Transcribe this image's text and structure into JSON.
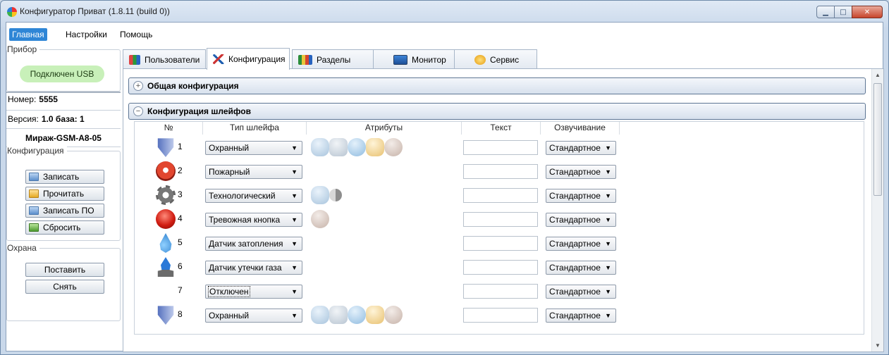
{
  "window": {
    "title": "Конфигуратор Приват (1.8.11 (build 0))",
    "min_glyph": "▁",
    "max_glyph": "□",
    "close_glyph": "✕"
  },
  "menu": [
    "Главная",
    "Настройки",
    "Помощь"
  ],
  "side": {
    "device_group": "Прибор",
    "usb_status": "Подключен USB",
    "number_label": "Номер:",
    "number_value": "5555",
    "version_label": "Версия:",
    "version_value": "1.0 база: 1",
    "device_name": "Мираж-GSM-A8-05",
    "config_group": "Конфигурация",
    "config_buttons": [
      "Записать",
      "Прочитать",
      "Записать ПО",
      "Сбросить"
    ],
    "guard_group": "Охрана",
    "guard_buttons": [
      "Поставить",
      "Снять"
    ]
  },
  "tabs": [
    "Пользователи",
    "Конфигурация",
    "Разделы",
    "Монитор",
    "Сервис"
  ],
  "panels": {
    "general": "Общая конфигурация",
    "loops": "Конфигурация шлейфов",
    "collapsed": "+",
    "expanded": "−"
  },
  "table": {
    "headers": [
      "№",
      "Тип шлейфа",
      "Атрибуты",
      "Текст",
      "Озвучивание"
    ],
    "rows": [
      {
        "num": "1",
        "icon": "shield-icon",
        "type": "Охранный",
        "sound": "Стандартное",
        "attrs": [
          "person-icon",
          "home-icon",
          "cycle-icon",
          "hand-icon",
          "sound-off-icon"
        ]
      },
      {
        "num": "2",
        "icon": "fire-icon",
        "type": "Пожарный",
        "sound": "Стандартное",
        "attrs": []
      },
      {
        "num": "3",
        "icon": "gear-icon",
        "type": "Технологический",
        "sound": "Стандартное",
        "attrs": [
          "person-icon",
          "half-circle-icon"
        ]
      },
      {
        "num": "4",
        "icon": "alarm-button-icon",
        "type": "Тревожная кнопка",
        "sound": "Стандартное",
        "attrs": [
          "sound-off-icon"
        ]
      },
      {
        "num": "5",
        "icon": "water-drop-icon",
        "type": "Датчик затопления",
        "sound": "Стандартное",
        "attrs": []
      },
      {
        "num": "6",
        "icon": "gas-flame-icon",
        "type": "Датчик утечки газа",
        "sound": "Стандартное",
        "attrs": []
      },
      {
        "num": "7",
        "icon": "",
        "type": "Отключен",
        "sound": "Стандартное",
        "attrs": []
      },
      {
        "num": "8",
        "icon": "shield-icon",
        "type": "Охранный",
        "sound": "Стандартное",
        "attrs": [
          "person-icon",
          "home-icon",
          "cycle-icon",
          "hand-icon",
          "sound-off-icon"
        ]
      }
    ],
    "dropdown_arrow": "▼"
  },
  "colors": {
    "accent": "#2f86d6",
    "usb_ok": "#c8f0b9"
  }
}
